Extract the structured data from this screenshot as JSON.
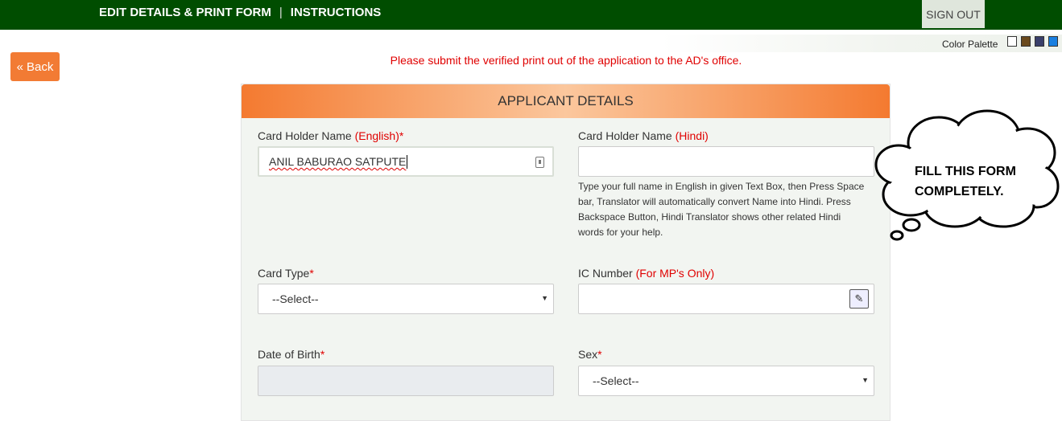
{
  "topnav": {
    "edit_label": "EDIT DETAILS & PRINT FORM",
    "separator": "|",
    "instructions_label": "INSTRUCTIONS",
    "signout_label": "SIGN OUT"
  },
  "palette": {
    "label": "Color Palette",
    "swatches": [
      "#ffffff",
      "#6b4a1e",
      "#3a3f6b",
      "#1a7fe0"
    ]
  },
  "back": {
    "label": "Back",
    "icon": "double-chevron-left-icon",
    "color": "#f27b34"
  },
  "notice": "Please submit the verified print out of the application to the AD's office.",
  "panel": {
    "title": "APPLICANT DETAILS"
  },
  "form": {
    "name_en": {
      "label": "Card Holder Name",
      "hint": "(English)*",
      "value": "ANIL BABURAO SATPUTE"
    },
    "name_hi": {
      "label": "Card Holder Name",
      "hint": "(Hindi)",
      "value": ""
    },
    "help_text": "Type your full name in English in given Text Box, then Press Space bar, Translator will automatically convert Name into Hindi. Press Backspace Button, Hindi Translator shows other related Hindi words for your help.",
    "card_type": {
      "label": "Card Type",
      "hint": "*",
      "selected": "--Select--"
    },
    "ic_number": {
      "label": "IC Number",
      "hint": "(For MP's Only)",
      "value": ""
    },
    "dob": {
      "label": "Date of Birth",
      "hint": "*",
      "value": ""
    },
    "sex": {
      "label": "Sex",
      "hint": "*",
      "selected": "--Select--"
    }
  },
  "callout": {
    "line1": "FILL THIS FORM",
    "line2": "COMPLETELY."
  }
}
